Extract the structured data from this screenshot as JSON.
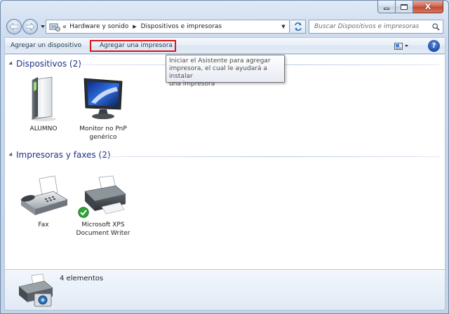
{
  "window": {
    "caption_buttons": {
      "close_glyph": "X"
    }
  },
  "address_bar": {
    "overflow_glyph": "«",
    "breadcrumbs": [
      "Hardware y sonido",
      "Dispositivos e impresoras"
    ]
  },
  "search": {
    "placeholder": "Buscar Dispositivos e impresoras"
  },
  "command_bar": {
    "add_device": "Agregar un dispositivo",
    "add_printer": "Agregar una impresora",
    "help_glyph": "?"
  },
  "tooltip": {
    "lines": [
      "Iniciar el Asistente para agregar",
      "impresora, el cual le ayudará a instalar",
      "una impresora"
    ]
  },
  "groups": [
    {
      "title": "Dispositivos (2)",
      "items": [
        {
          "label_lines": [
            "ALUMNO"
          ],
          "icon": "computer-tower-icon"
        },
        {
          "label_lines": [
            "Monitor no PnP",
            "genérico"
          ],
          "icon": "monitor-icon"
        }
      ]
    },
    {
      "title": "Impresoras y faxes (2)",
      "items": [
        {
          "label_lines": [
            "Fax"
          ],
          "icon": "fax-icon"
        },
        {
          "label_lines": [
            "Microsoft XPS",
            "Document Writer"
          ],
          "icon": "default-printer-icon"
        }
      ]
    }
  ],
  "details": {
    "count_text": "4 elementos",
    "icon": "printer-camera-icon"
  },
  "colors": {
    "group_title": "#1e3287",
    "highlight_border": "#d6151b",
    "default_check": "#2ea43a"
  }
}
